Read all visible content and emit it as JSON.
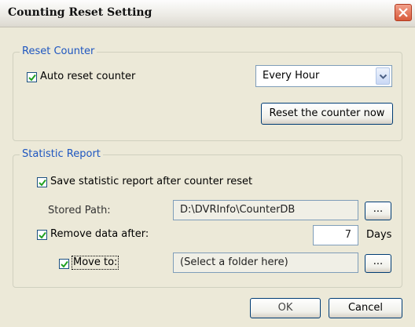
{
  "window": {
    "title": "Counting Reset Setting"
  },
  "reset_counter": {
    "group_title": "Reset Counter",
    "auto_reset_label": "Auto reset counter",
    "auto_reset_checked": true,
    "interval_value": "Every Hour",
    "reset_now_label": "Reset the counter now"
  },
  "statistic_report": {
    "group_title": "Statistic Report",
    "save_report_label": "Save statistic report after counter reset",
    "save_report_checked": true,
    "stored_path_label": "Stored Path:",
    "stored_path_value": "D:\\DVRInfo\\CounterDB",
    "browse_label": "...",
    "remove_label": "Remove data after:",
    "remove_checked": true,
    "remove_days_value": "7",
    "days_unit": "Days",
    "move_to_label": "Move to:",
    "move_to_checked": true,
    "move_to_value": "(Select a folder here)",
    "browse2_label": "..."
  },
  "footer": {
    "ok_label": "OK",
    "cancel_label": "Cancel"
  }
}
